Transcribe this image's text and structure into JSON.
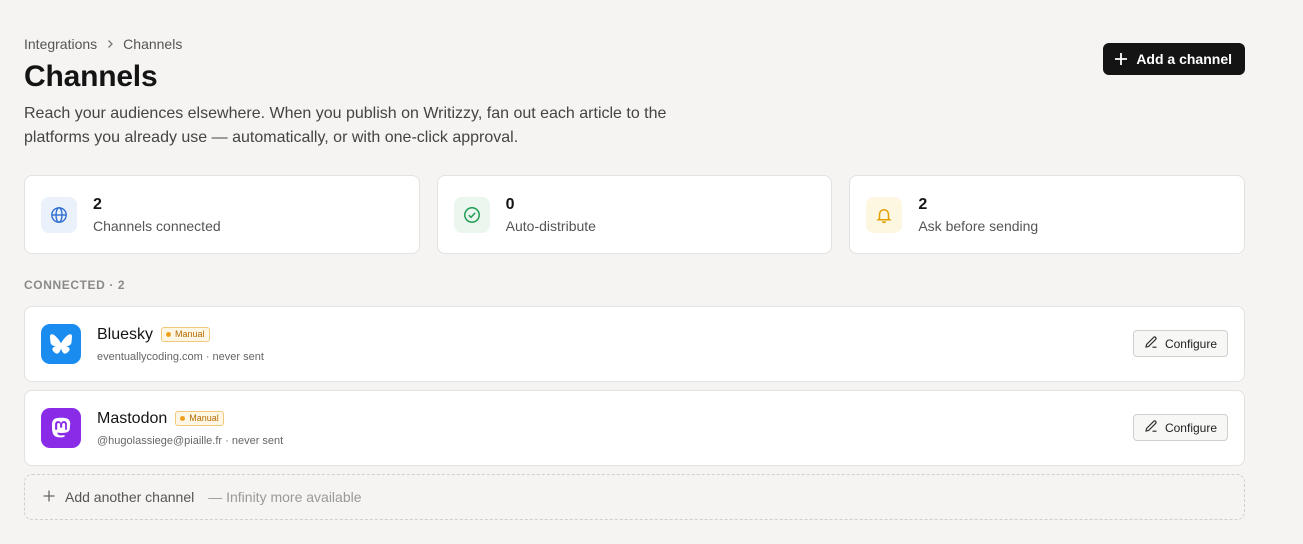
{
  "breadcrumb": {
    "parent": "Integrations",
    "current": "Channels"
  },
  "header": {
    "title": "Channels",
    "subtitle": "Reach your audiences elsewhere. When you publish on Writizzy, fan out each article to the platforms you already use — automatically, or with one-click approval.",
    "add_button_label": "Add a channel"
  },
  "stats": [
    {
      "value": "2",
      "label": "Channels connected",
      "icon": "globe-icon",
      "color": "#2f6fd0"
    },
    {
      "value": "0",
      "label": "Auto-distribute",
      "icon": "check-circle-icon",
      "color": "#1f9d55"
    },
    {
      "value": "2",
      "label": "Ask before sending",
      "icon": "bell-icon",
      "color": "#e0a000"
    }
  ],
  "section": {
    "label": "CONNECTED · 2"
  },
  "channels": [
    {
      "name": "Bluesky",
      "badge": "Manual",
      "meta": "eventuallycoding.com · never sent",
      "icon": "butterfly-icon",
      "color": "#1a8cf0",
      "action": "Configure"
    },
    {
      "name": "Mastodon",
      "badge": "Manual",
      "meta": "@hugolassiege@piaille.fr · never sent",
      "icon": "mastodon-icon",
      "color": "#8a2be8",
      "action": "Configure"
    }
  ],
  "add_another": {
    "label": "Add another channel",
    "note": "— Infinity more available"
  }
}
